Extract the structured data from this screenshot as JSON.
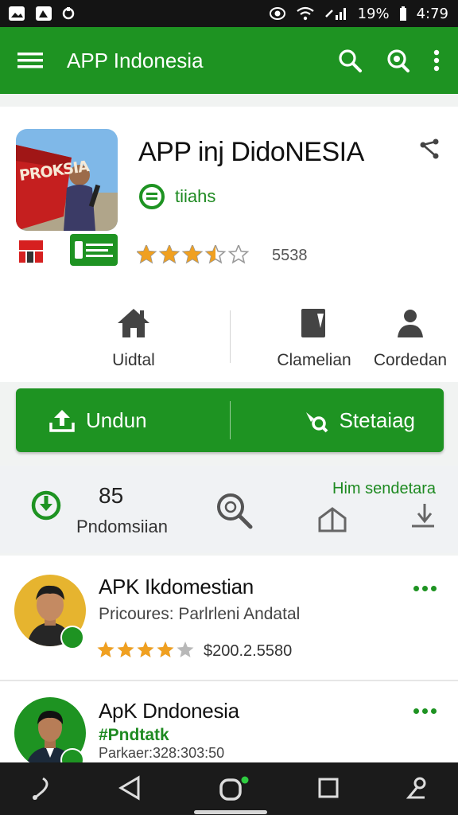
{
  "status_bar": {
    "battery_text": "19%",
    "time": "4:79",
    "icons": [
      "image-icon",
      "gallery-icon",
      "sync-icon",
      "eye-icon",
      "wifi-icon",
      "signal-icon",
      "battery-icon"
    ]
  },
  "app_bar": {
    "title": "APP Indonesia",
    "icons": [
      "menu-icon",
      "search-icon",
      "search-icon",
      "more-vert-icon"
    ]
  },
  "app_header": {
    "title": "APP inj DidoNESIA",
    "icon_text": "PROKSIA",
    "category": "tiiahs",
    "rating": 3.5,
    "rating_count": "5538"
  },
  "info_row": {
    "items": [
      {
        "label": "Uidtal",
        "icon": "home-icon"
      },
      {
        "label": "Clamelian",
        "icon": "book-icon"
      },
      {
        "label": "Cordedan",
        "icon": "person-icon"
      }
    ]
  },
  "action_bar": {
    "primary_label": "Undun",
    "secondary_label": "Stetaiag"
  },
  "stats": {
    "count": "85",
    "count_label": "Pndomsiian",
    "link_text": "Him sendetara"
  },
  "list": [
    {
      "title": "APK Ikdomestian",
      "subtitle": "Pricoures: Parlrleni Andatal",
      "rating": 4,
      "price": "$200.2.5580"
    },
    {
      "title": "ApK Dndonesia",
      "tag": "#Pndtatk",
      "meta": "Parkaer:328:303:50"
    }
  ],
  "colors": {
    "primary_green": "#1e9322",
    "status_bar": "#141414",
    "star": "#f0a020",
    "nav_bar": "#1b1b1b"
  }
}
